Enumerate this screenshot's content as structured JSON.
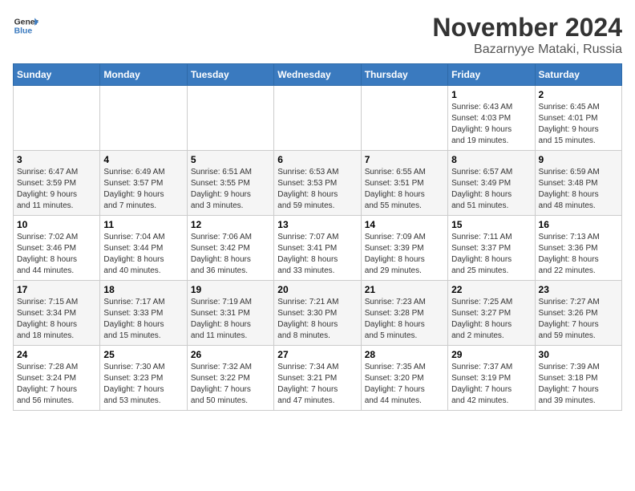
{
  "header": {
    "logo_line1": "General",
    "logo_line2": "Blue",
    "month": "November 2024",
    "location": "Bazarnyye Mataki, Russia"
  },
  "weekdays": [
    "Sunday",
    "Monday",
    "Tuesday",
    "Wednesday",
    "Thursday",
    "Friday",
    "Saturday"
  ],
  "weeks": [
    [
      {
        "day": "",
        "info": ""
      },
      {
        "day": "",
        "info": ""
      },
      {
        "day": "",
        "info": ""
      },
      {
        "day": "",
        "info": ""
      },
      {
        "day": "",
        "info": ""
      },
      {
        "day": "1",
        "info": "Sunrise: 6:43 AM\nSunset: 4:03 PM\nDaylight: 9 hours\nand 19 minutes."
      },
      {
        "day": "2",
        "info": "Sunrise: 6:45 AM\nSunset: 4:01 PM\nDaylight: 9 hours\nand 15 minutes."
      }
    ],
    [
      {
        "day": "3",
        "info": "Sunrise: 6:47 AM\nSunset: 3:59 PM\nDaylight: 9 hours\nand 11 minutes."
      },
      {
        "day": "4",
        "info": "Sunrise: 6:49 AM\nSunset: 3:57 PM\nDaylight: 9 hours\nand 7 minutes."
      },
      {
        "day": "5",
        "info": "Sunrise: 6:51 AM\nSunset: 3:55 PM\nDaylight: 9 hours\nand 3 minutes."
      },
      {
        "day": "6",
        "info": "Sunrise: 6:53 AM\nSunset: 3:53 PM\nDaylight: 8 hours\nand 59 minutes."
      },
      {
        "day": "7",
        "info": "Sunrise: 6:55 AM\nSunset: 3:51 PM\nDaylight: 8 hours\nand 55 minutes."
      },
      {
        "day": "8",
        "info": "Sunrise: 6:57 AM\nSunset: 3:49 PM\nDaylight: 8 hours\nand 51 minutes."
      },
      {
        "day": "9",
        "info": "Sunrise: 6:59 AM\nSunset: 3:48 PM\nDaylight: 8 hours\nand 48 minutes."
      }
    ],
    [
      {
        "day": "10",
        "info": "Sunrise: 7:02 AM\nSunset: 3:46 PM\nDaylight: 8 hours\nand 44 minutes."
      },
      {
        "day": "11",
        "info": "Sunrise: 7:04 AM\nSunset: 3:44 PM\nDaylight: 8 hours\nand 40 minutes."
      },
      {
        "day": "12",
        "info": "Sunrise: 7:06 AM\nSunset: 3:42 PM\nDaylight: 8 hours\nand 36 minutes."
      },
      {
        "day": "13",
        "info": "Sunrise: 7:07 AM\nSunset: 3:41 PM\nDaylight: 8 hours\nand 33 minutes."
      },
      {
        "day": "14",
        "info": "Sunrise: 7:09 AM\nSunset: 3:39 PM\nDaylight: 8 hours\nand 29 minutes."
      },
      {
        "day": "15",
        "info": "Sunrise: 7:11 AM\nSunset: 3:37 PM\nDaylight: 8 hours\nand 25 minutes."
      },
      {
        "day": "16",
        "info": "Sunrise: 7:13 AM\nSunset: 3:36 PM\nDaylight: 8 hours\nand 22 minutes."
      }
    ],
    [
      {
        "day": "17",
        "info": "Sunrise: 7:15 AM\nSunset: 3:34 PM\nDaylight: 8 hours\nand 18 minutes."
      },
      {
        "day": "18",
        "info": "Sunrise: 7:17 AM\nSunset: 3:33 PM\nDaylight: 8 hours\nand 15 minutes."
      },
      {
        "day": "19",
        "info": "Sunrise: 7:19 AM\nSunset: 3:31 PM\nDaylight: 8 hours\nand 11 minutes."
      },
      {
        "day": "20",
        "info": "Sunrise: 7:21 AM\nSunset: 3:30 PM\nDaylight: 8 hours\nand 8 minutes."
      },
      {
        "day": "21",
        "info": "Sunrise: 7:23 AM\nSunset: 3:28 PM\nDaylight: 8 hours\nand 5 minutes."
      },
      {
        "day": "22",
        "info": "Sunrise: 7:25 AM\nSunset: 3:27 PM\nDaylight: 8 hours\nand 2 minutes."
      },
      {
        "day": "23",
        "info": "Sunrise: 7:27 AM\nSunset: 3:26 PM\nDaylight: 7 hours\nand 59 minutes."
      }
    ],
    [
      {
        "day": "24",
        "info": "Sunrise: 7:28 AM\nSunset: 3:24 PM\nDaylight: 7 hours\nand 56 minutes."
      },
      {
        "day": "25",
        "info": "Sunrise: 7:30 AM\nSunset: 3:23 PM\nDaylight: 7 hours\nand 53 minutes."
      },
      {
        "day": "26",
        "info": "Sunrise: 7:32 AM\nSunset: 3:22 PM\nDaylight: 7 hours\nand 50 minutes."
      },
      {
        "day": "27",
        "info": "Sunrise: 7:34 AM\nSunset: 3:21 PM\nDaylight: 7 hours\nand 47 minutes."
      },
      {
        "day": "28",
        "info": "Sunrise: 7:35 AM\nSunset: 3:20 PM\nDaylight: 7 hours\nand 44 minutes."
      },
      {
        "day": "29",
        "info": "Sunrise: 7:37 AM\nSunset: 3:19 PM\nDaylight: 7 hours\nand 42 minutes."
      },
      {
        "day": "30",
        "info": "Sunrise: 7:39 AM\nSunset: 3:18 PM\nDaylight: 7 hours\nand 39 minutes."
      }
    ]
  ]
}
